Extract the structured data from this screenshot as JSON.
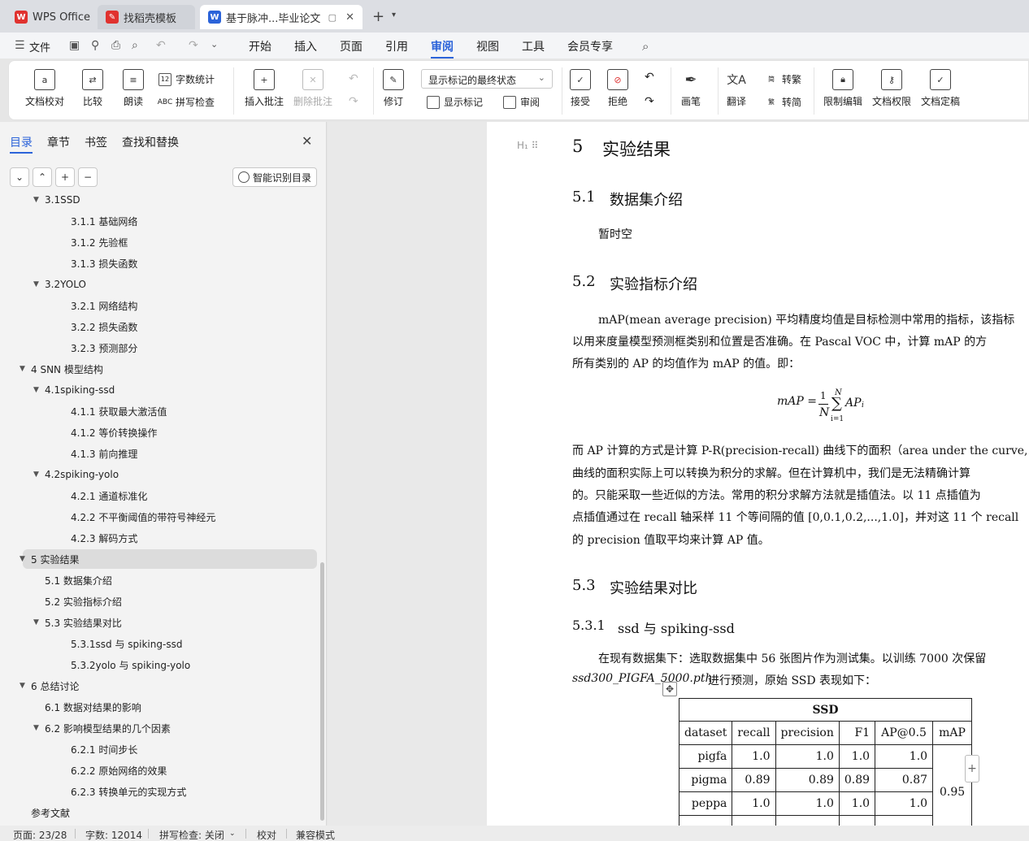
{
  "tabs": {
    "wps": "WPS Office",
    "template": "找稻壳模板",
    "doc": "基于脉冲...毕业论文"
  },
  "menu": {
    "file": "文件",
    "items": [
      "开始",
      "插入",
      "页面",
      "引用",
      "审阅",
      "视图",
      "工具",
      "会员专享"
    ],
    "active": "审阅"
  },
  "ribbon": {
    "doc_check": "文档校对",
    "compare": "比较",
    "read_aloud": "朗读",
    "word_count": "字数统计",
    "spell_check": "拼写检查",
    "insert_comment": "插入批注",
    "delete_comment": "删除批注",
    "revise": "修订",
    "markup_state": "显示标记的最终状态",
    "show_markup": "显示标记",
    "review": "审阅",
    "accept": "接受",
    "reject": "拒绝",
    "pen": "画笔",
    "translate": "翻译",
    "to_trad": "转繁",
    "to_simp": "转简",
    "restrict_edit": "限制编辑",
    "doc_permission": "文档权限",
    "finalize": "文档定稿"
  },
  "panel": {
    "tabs": [
      "目录",
      "章节",
      "书签",
      "查找和替换"
    ],
    "smart_toc": "智能识别目录",
    "toc": [
      {
        "level": 2,
        "label": "3.1SSD",
        "expanded": true
      },
      {
        "level": 3,
        "label": "3.1.1  基础网络"
      },
      {
        "level": 3,
        "label": "3.1.2  先验框"
      },
      {
        "level": 3,
        "label": "3.1.3  损失函数"
      },
      {
        "level": 2,
        "label": "3.2YOLO",
        "expanded": true
      },
      {
        "level": 3,
        "label": "3.2.1  网络结构"
      },
      {
        "level": 3,
        "label": "3.2.2  损失函数"
      },
      {
        "level": 3,
        "label": "3.2.3    预测部分"
      },
      {
        "level": 1,
        "label": "4  SNN 模型结构",
        "expanded": true
      },
      {
        "level": 2,
        "label": "4.1spiking-ssd",
        "expanded": true
      },
      {
        "level": 3,
        "label": "4.1.1  获取最大激活值"
      },
      {
        "level": 3,
        "label": "4.1.2  等价转换操作"
      },
      {
        "level": 3,
        "label": "4.1.3  前向推理"
      },
      {
        "level": 2,
        "label": "4.2spiking-yolo",
        "expanded": true
      },
      {
        "level": 3,
        "label": "4.2.1  通道标准化"
      },
      {
        "level": 3,
        "label": "4.2.2  不平衡阈值的带符号神经元"
      },
      {
        "level": 3,
        "label": "4.2.3  解码方式"
      },
      {
        "level": 1,
        "label": "5  实验结果",
        "expanded": true,
        "selected": true
      },
      {
        "level": 2,
        "label": "5.1  数据集介绍"
      },
      {
        "level": 2,
        "label": "5.2  实验指标介绍"
      },
      {
        "level": 2,
        "label": "5.3  实验结果对比",
        "expanded": true
      },
      {
        "level": 3,
        "label": "5.3.1ssd 与 spiking-ssd"
      },
      {
        "level": 3,
        "label": "5.3.2yolo 与 spiking-yolo"
      },
      {
        "level": 1,
        "label": "6  总结讨论",
        "expanded": true
      },
      {
        "level": 2,
        "label": "6.1  数据对结果的影响"
      },
      {
        "level": 2,
        "label": "6.2  影响模型结果的几个因素",
        "expanded": true
      },
      {
        "level": 3,
        "label": "6.2.1  时间步长"
      },
      {
        "level": 3,
        "label": "6.2.2  原始网络的效果"
      },
      {
        "level": 3,
        "label": "6.2.3  转换单元的实现方式"
      },
      {
        "level": 1,
        "label": "参考文献"
      }
    ]
  },
  "doc": {
    "h1_num": "5",
    "h1_title": "实验结果",
    "s51_num": "5.1",
    "s51_title": "数据集介绍",
    "s51_body": "暂时空",
    "s52_num": "5.2",
    "s52_title": "实验指标介绍",
    "p1_l1": "mAP(mean average precision) 平均精度均值是目标检测中常用的指标，该指标",
    "p1_l2": "以用来度量模型预测框类别和位置是否准确。在 Pascal VOC 中，计算 mAP 的方",
    "p1_l3": "所有类别的 AP 的均值作为 mAP 的值。即：",
    "formula_lhs": "mAP =",
    "formula_num": "1",
    "formula_den": "N",
    "formula_sum_top": "N",
    "formula_sum": "∑",
    "formula_sum_bot": "i=1",
    "formula_term": "AP",
    "formula_sub": "i",
    "p2_l1": "而 AP 计算的方式是计算 P-R(precision-recall) 曲线下的面积（area under the curve,",
    "p2_l2": "曲线的面积实际上可以转换为积分的求解。但在计算机中，我们是无法精确计算",
    "p2_l3": "的。只能采取一些近似的方法。常用的积分求解方法就是插值法。以 11 点插值为",
    "p2_l4": "点插值通过在 recall 轴采样 11 个等间隔的值 [0,0.1,0.2,...,1.0]，并对这 11 个 recall",
    "p2_l5": "的 precision 值取平均来计算 AP 值。",
    "s53_num": "5.3",
    "s53_title": "实验结果对比",
    "s531_num": "5.3.1",
    "s531_title": "ssd 与 spiking-ssd",
    "p3_l1": "在现有数据集下：选取数据集中 56 张图片作为测试集。以训练 7000 次保留",
    "p3_l2a": "ssd300_PIGFA_5000.pth",
    "p3_l2b": " 进行预测，原始 SSD 表现如下：",
    "table": {
      "title": "SSD",
      "headers": [
        "dataset",
        "recall",
        "precision",
        "F1",
        "AP@0.5",
        "mAP"
      ],
      "rows": [
        [
          "pigfa",
          "1.0",
          "1.0",
          "1.0",
          "1.0"
        ],
        [
          "pigma",
          "0.89",
          "0.89",
          "0.89",
          "0.87"
        ],
        [
          "peppa",
          "1.0",
          "1.0",
          "1.0",
          "1.0"
        ]
      ],
      "map": "0.95"
    }
  },
  "status": {
    "page": "页面: 23/28",
    "words": "字数: 12014",
    "spell": "拼写检查: 关闭",
    "proof": "校对",
    "compat": "兼容模式"
  }
}
